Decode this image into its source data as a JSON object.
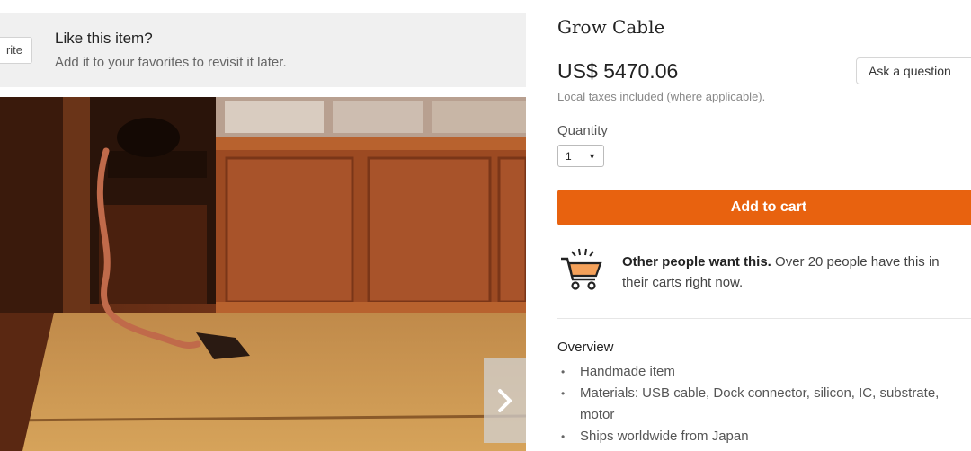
{
  "favorites_banner": {
    "button_label": "rite",
    "title": "Like this item?",
    "subtitle": "Add it to your favorites to revisit it later."
  },
  "gallery": {
    "next_icon": "chevron-right-icon"
  },
  "product": {
    "title": "Grow Cable",
    "price": "US$ 5470.06",
    "tax_note": "Local taxes included (where applicable).",
    "ask_button": "Ask a question"
  },
  "quantity": {
    "label": "Quantity",
    "selected": "1"
  },
  "cart": {
    "button_label": "Add to cart",
    "icon": "shopping-cart-icon",
    "accent_color": "#e8620f"
  },
  "demand": {
    "bold": "Other people want this.",
    "text": " Over 20 people have this in their carts right now."
  },
  "overview": {
    "title": "Overview",
    "items": [
      "Handmade item",
      "Materials: USB cable, Dock connector, silicon, IC, substrate, motor",
      "Ships worldwide from Japan"
    ]
  }
}
